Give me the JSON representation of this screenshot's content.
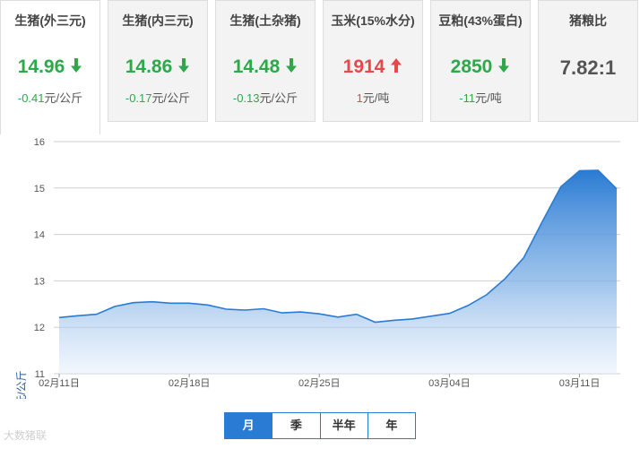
{
  "cards": [
    {
      "title": "生猪(外三元)",
      "price": "14.96",
      "trend": "down",
      "change": "-0.41",
      "unit": "元/公斤"
    },
    {
      "title": "生猪(内三元)",
      "price": "14.86",
      "trend": "down",
      "change": "-0.17",
      "unit": "元/公斤"
    },
    {
      "title": "生猪(土杂猪)",
      "price": "14.48",
      "trend": "down",
      "change": "-0.13",
      "unit": "元/公斤"
    },
    {
      "title": "玉米(15%水分)",
      "price": "1914",
      "trend": "up",
      "change": "1",
      "unit": "元/吨"
    },
    {
      "title": "豆粕(43%蛋白)",
      "price": "2850",
      "trend": "down",
      "change": "-11",
      "unit": "元/吨"
    },
    {
      "title": "猪粮比",
      "price": "7.82:1",
      "trend": "neutral",
      "change": "",
      "unit": ""
    }
  ],
  "colors": {
    "down": "#2ea84a",
    "up": "#e5484d",
    "series": "#2a7bd3"
  },
  "chart_data": {
    "type": "area",
    "ylabel": "元/公斤",
    "ylim": [
      11,
      16
    ],
    "yticks": [
      11,
      12,
      13,
      14,
      15,
      16
    ],
    "x": [
      "02月11日",
      "02月12日",
      "02月13日",
      "02月14日",
      "02月15日",
      "02月16日",
      "02月17日",
      "02月18日",
      "02月19日",
      "02月20日",
      "02月21日",
      "02月22日",
      "02月23日",
      "02月24日",
      "02月25日",
      "02月26日",
      "02月27日",
      "02月28日",
      "03月01日",
      "03月02日",
      "03月03日",
      "03月04日",
      "03月05日",
      "03月06日",
      "03月07日",
      "03月08日",
      "03月09日",
      "03月10日",
      "03月11日",
      "03月12日",
      "03月13日"
    ],
    "xticks": [
      "02月11日",
      "02月18日",
      "02月25日",
      "03月04日",
      "03月11日"
    ],
    "series": [
      {
        "values": [
          12.21,
          12.25,
          12.28,
          12.45,
          12.53,
          12.55,
          12.52,
          12.52,
          12.48,
          12.39,
          12.37,
          12.4,
          12.31,
          12.33,
          12.29,
          12.22,
          12.28,
          12.11,
          12.15,
          12.18,
          12.24,
          12.3,
          12.47,
          12.7,
          13.05,
          13.5,
          14.28,
          15.03,
          15.37,
          15.38,
          14.98
        ]
      }
    ],
    "grid": true,
    "legend": "none"
  },
  "tabs": [
    {
      "label": "月",
      "active": true
    },
    {
      "label": "季",
      "active": false
    },
    {
      "label": "半年",
      "active": false
    },
    {
      "label": "年",
      "active": false
    }
  ],
  "watermark": "大数猪联"
}
